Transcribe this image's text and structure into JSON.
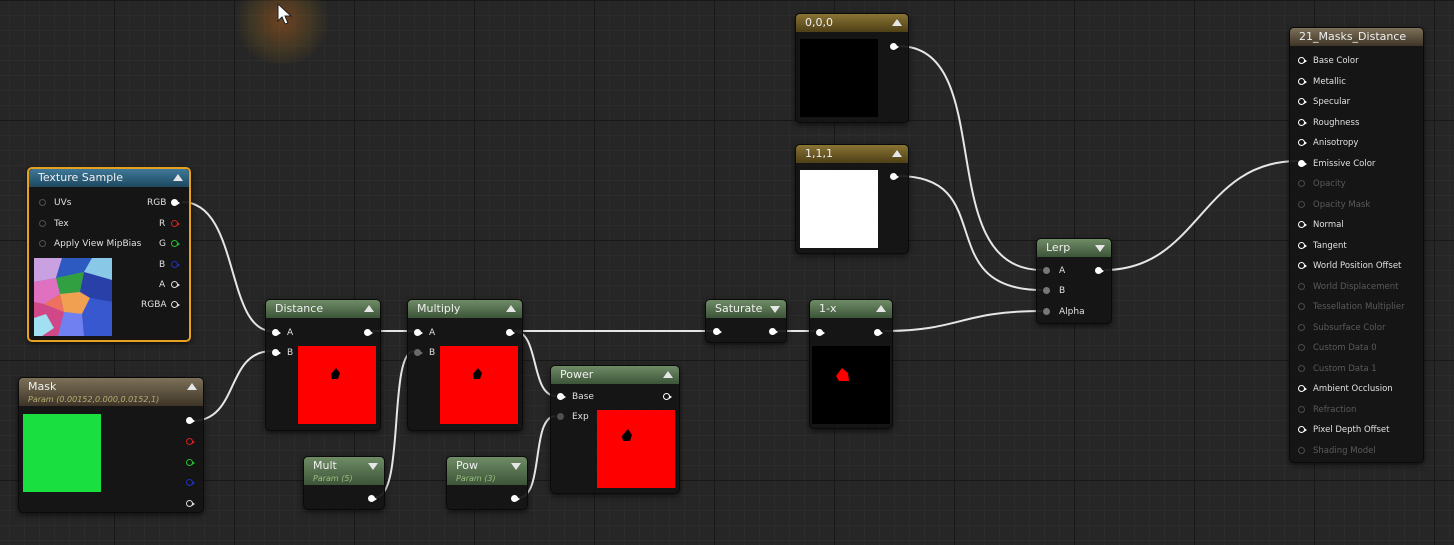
{
  "cursor_icon": "hand-grab-icon",
  "nodes": {
    "constant_000": {
      "title": "0,0,0",
      "preview_color": "#000000"
    },
    "constant_111": {
      "title": "1,1,1",
      "preview_color": "#ffffff"
    },
    "texture_sample": {
      "title": "Texture Sample",
      "inputs": [
        "UVs",
        "Tex",
        "Apply View MipBias"
      ],
      "outputs": [
        "RGB",
        "R",
        "G",
        "B",
        "A",
        "RGBA"
      ]
    },
    "mask": {
      "title": "Mask",
      "subtitle": "Param (0.00152,0.000,0.0152,1)",
      "preview_color": "#19e040"
    },
    "distance": {
      "title": "Distance",
      "inputs": [
        "A",
        "B"
      ]
    },
    "multiply": {
      "title": "Multiply",
      "inputs": [
        "A",
        "B"
      ]
    },
    "mult": {
      "title": "Mult",
      "subtitle": "Param (5)"
    },
    "pow": {
      "title": "Pow",
      "subtitle": "Param (3)"
    },
    "power": {
      "title": "Power",
      "inputs": [
        "Base",
        "Exp"
      ]
    },
    "saturate": {
      "title": "Saturate"
    },
    "one_minus": {
      "title": "1-x"
    },
    "lerp": {
      "title": "Lerp",
      "inputs": [
        "A",
        "B",
        "Alpha"
      ]
    },
    "material": {
      "title": "21_Masks_Distance",
      "pins": [
        {
          "label": "Base Color",
          "enabled": true
        },
        {
          "label": "Metallic",
          "enabled": true
        },
        {
          "label": "Specular",
          "enabled": true
        },
        {
          "label": "Roughness",
          "enabled": true
        },
        {
          "label": "Anisotropy",
          "enabled": true
        },
        {
          "label": "Emissive Color",
          "enabled": true,
          "connected": true
        },
        {
          "label": "Opacity",
          "enabled": false
        },
        {
          "label": "Opacity Mask",
          "enabled": false
        },
        {
          "label": "Normal",
          "enabled": true
        },
        {
          "label": "Tangent",
          "enabled": true
        },
        {
          "label": "World Position Offset",
          "enabled": true
        },
        {
          "label": "World Displacement",
          "enabled": false
        },
        {
          "label": "Tessellation Multiplier",
          "enabled": false
        },
        {
          "label": "Subsurface Color",
          "enabled": false
        },
        {
          "label": "Custom Data 0",
          "enabled": false
        },
        {
          "label": "Custom Data 1",
          "enabled": false
        },
        {
          "label": "Ambient Occlusion",
          "enabled": true
        },
        {
          "label": "Refraction",
          "enabled": false
        },
        {
          "label": "Pixel Depth Offset",
          "enabled": true
        },
        {
          "label": "Shading Model",
          "enabled": false
        }
      ]
    }
  },
  "colors": {
    "wire": "#e6e6e6",
    "pin_red": "#d42020",
    "pin_green": "#22c030",
    "pin_blue": "#2030c0",
    "preview_red": "#ff0000",
    "preview_black": "#000000",
    "selection": "#e8a020"
  }
}
